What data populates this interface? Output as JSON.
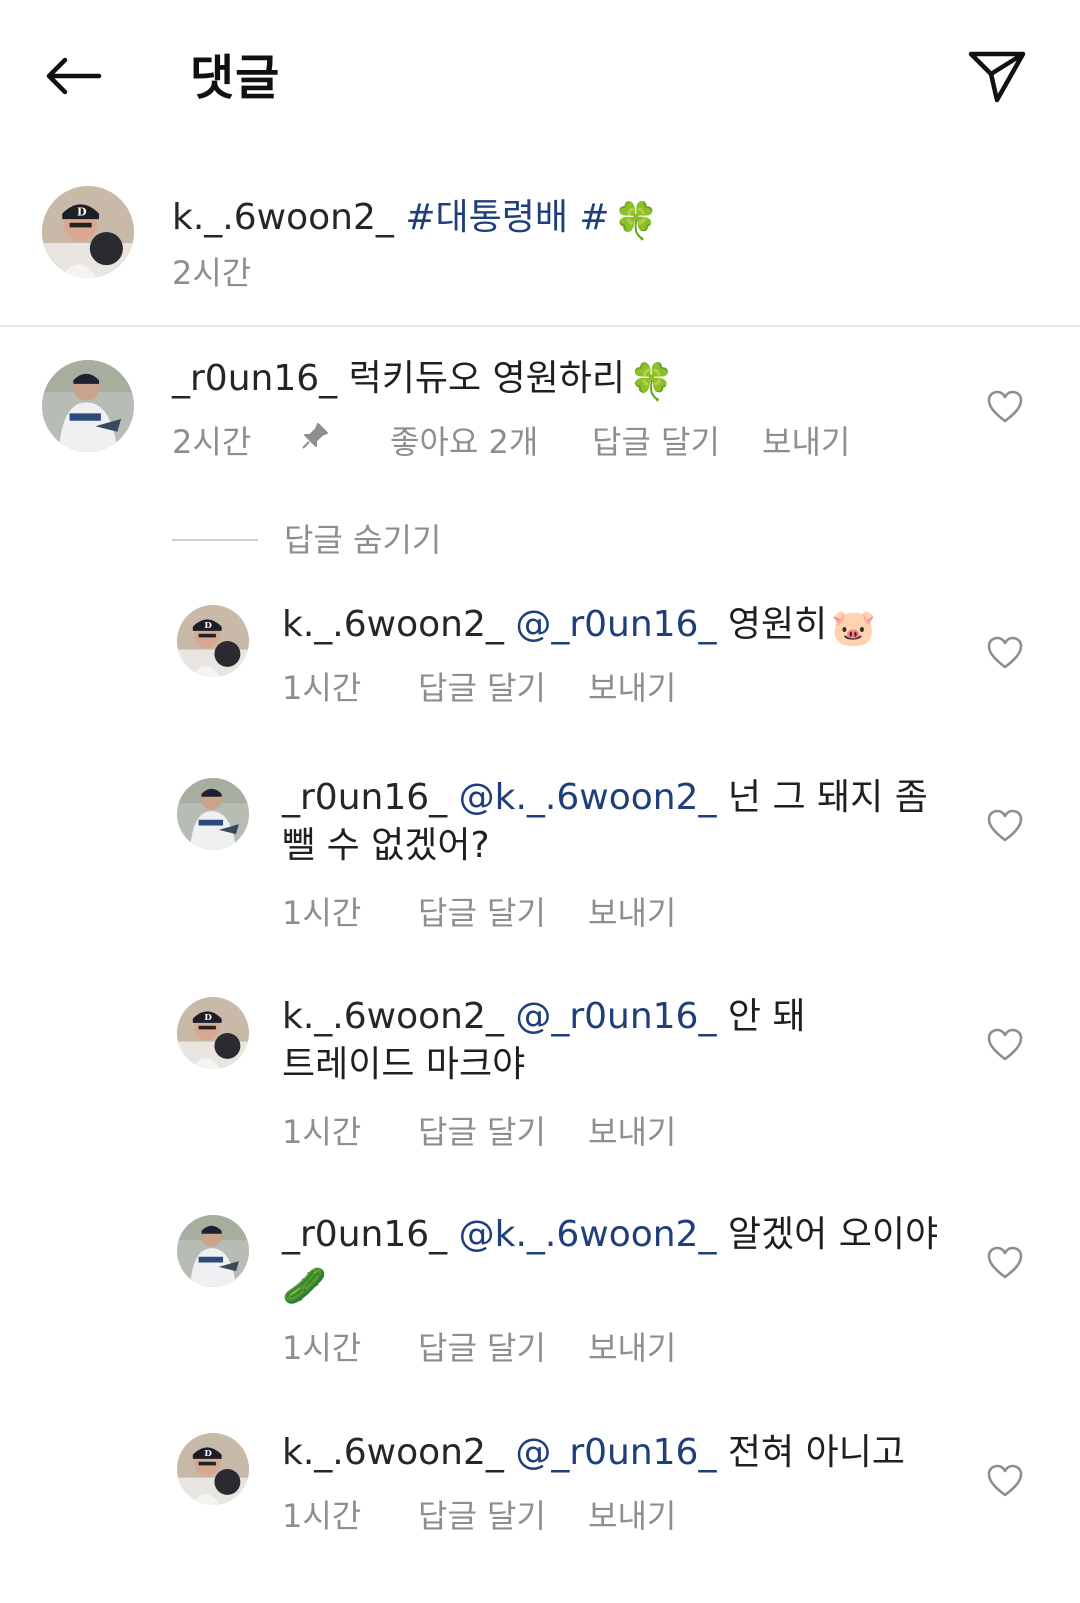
{
  "header": {
    "title": "댓글",
    "back_icon": "arrow-left-icon",
    "send_icon": "paper-plane-icon"
  },
  "caption": {
    "username": "k._.6woon2_",
    "text": "#대통령배 #",
    "emoji": "🍀",
    "time": "2시간"
  },
  "comments": [
    {
      "username": "_r0un16_",
      "text": "럭키듀오 영원하리",
      "emoji": "🍀",
      "time": "2시간",
      "pinned_icon": "pin-icon",
      "likes": "좋아요 2개",
      "reply_label": "답글 달기",
      "send_label": "보내기"
    }
  ],
  "hide_replies_label": "답글 숨기기",
  "replies": [
    {
      "username": "k._.6woon2_",
      "mention": "@_r0un16_",
      "text": "영원히",
      "emoji": "🐷",
      "time": "1시간",
      "reply_label": "답글 달기",
      "send_label": "보내기"
    },
    {
      "username": "_r0un16_",
      "mention": "@k._.6woon2_",
      "text_line1": "넌 그 돼지 좀",
      "text_line2": "뺄 수 없겠어?",
      "time": "1시간",
      "reply_label": "답글 달기",
      "send_label": "보내기"
    },
    {
      "username": "k._.6woon2_",
      "mention": "@_r0un16_",
      "text_line1": "안 돼",
      "text_line2": "트레이드 마크야",
      "time": "1시간",
      "reply_label": "답글 달기",
      "send_label": "보내기"
    },
    {
      "username": "_r0un16_",
      "mention": "@k._.6woon2_",
      "text_line1": "알겠어 오이야",
      "emoji": "🥒",
      "time": "1시간",
      "reply_label": "답글 달기",
      "send_label": "보내기"
    },
    {
      "username": "k._.6woon2_",
      "mention": "@_r0un16_",
      "text": "전혀 아니고",
      "time": "1시간",
      "reply_label": "답글 달기",
      "send_label": "보내기"
    }
  ],
  "colors": {
    "mention": "#1f3f7a",
    "muted": "#8e8e8e",
    "text": "#1f1f1f"
  }
}
